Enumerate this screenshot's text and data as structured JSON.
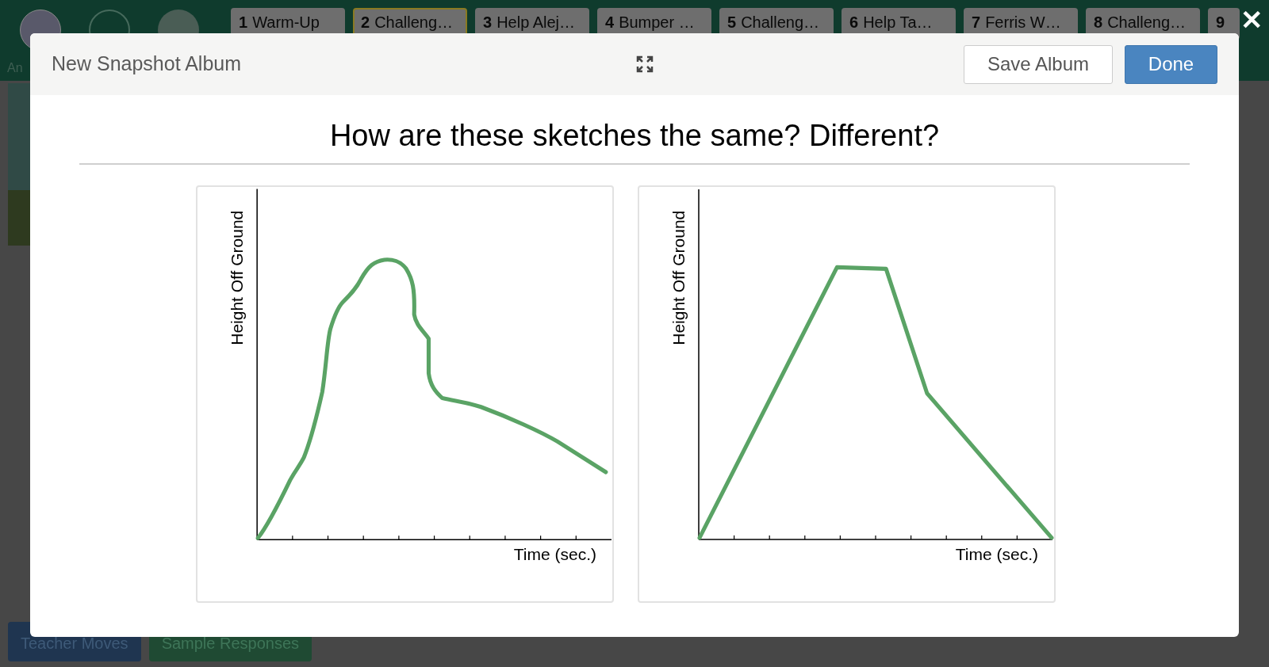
{
  "top_bar": {
    "user_label": "An",
    "tabs": [
      {
        "number": "1",
        "label": "Warm-Up",
        "selected": false
      },
      {
        "number": "2",
        "label": "Challeng…",
        "selected": true
      },
      {
        "number": "3",
        "label": "Help Alej…",
        "selected": false
      },
      {
        "number": "4",
        "label": "Bumper …",
        "selected": false
      },
      {
        "number": "5",
        "label": "Challeng…",
        "selected": false
      },
      {
        "number": "6",
        "label": "Help Ta…",
        "selected": false
      },
      {
        "number": "7",
        "label": "Ferris W…",
        "selected": false
      },
      {
        "number": "8",
        "label": "Challeng…",
        "selected": false
      },
      {
        "number": "9",
        "selected": false
      }
    ]
  },
  "bottom_buttons": [
    {
      "label": "Teacher Moves",
      "kind": "blue"
    },
    {
      "label": "Sample Responses",
      "kind": "green"
    }
  ],
  "close_label": "✕",
  "modal": {
    "title": "New Snapshot Album",
    "buttons": [
      {
        "label": "Save Album",
        "kind": "secondary"
      },
      {
        "label": "Done",
        "kind": "primary"
      }
    ],
    "heading": "How are these sketches the same? Different?",
    "sketches": [
      {
        "kind": "curve",
        "y_label": "Height Off Ground",
        "x_label": "Time (sec.)"
      },
      {
        "kind": "trapezoid",
        "y_label": "Height Off Ground",
        "x_label": "Time (sec.)"
      }
    ]
  }
}
